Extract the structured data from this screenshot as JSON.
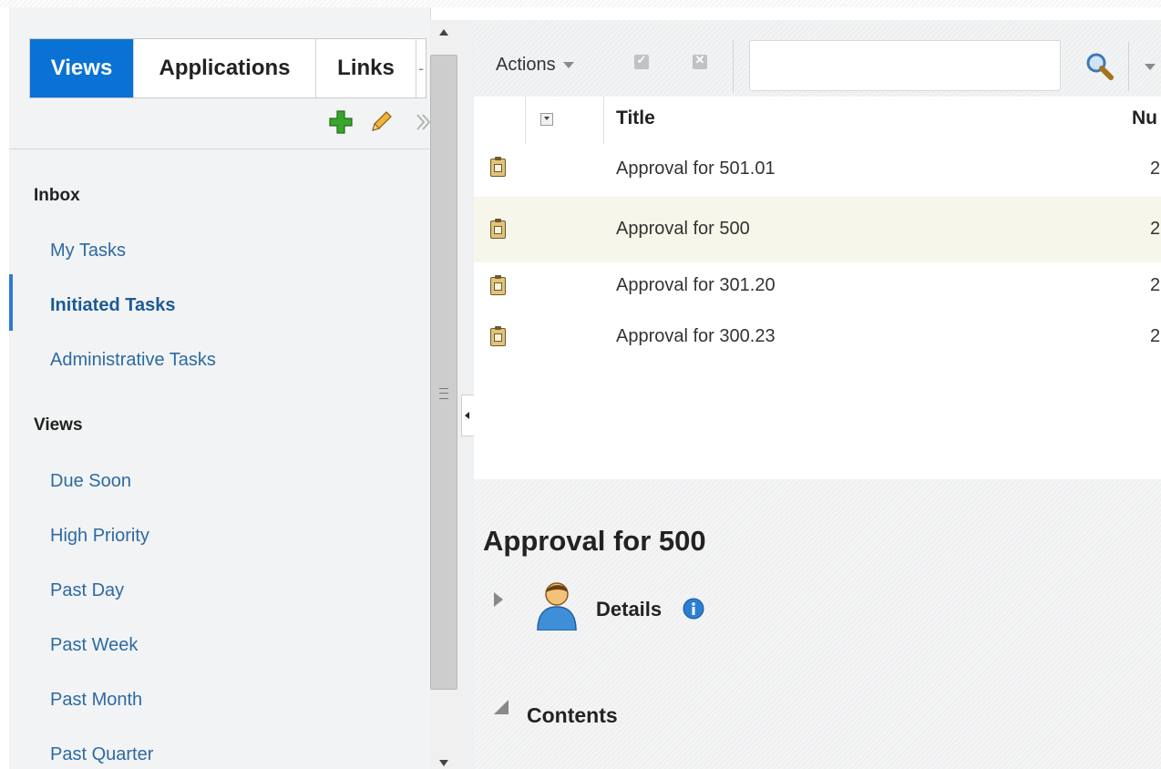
{
  "tabs": {
    "views": "Views",
    "applications": "Applications",
    "links": "Links",
    "more": "-"
  },
  "sidebar": {
    "toolbar_icons": [
      "add-icon",
      "edit-pencil-icon",
      "chevron-right-icon"
    ],
    "inbox_heading": "Inbox",
    "inbox_items": [
      {
        "label": "My Tasks"
      },
      {
        "label": "Initiated Tasks",
        "selected": true
      },
      {
        "label": "Administrative Tasks"
      }
    ],
    "views_heading": "Views",
    "views_items": [
      {
        "label": "Due Soon"
      },
      {
        "label": "High Priority"
      },
      {
        "label": "Past Day"
      },
      {
        "label": "Past Week"
      },
      {
        "label": "Past Month"
      },
      {
        "label": "Past Quarter"
      }
    ]
  },
  "toolbar": {
    "actions_label": "Actions",
    "search_value": ""
  },
  "table": {
    "columns": {
      "title": "Title",
      "number": "Nu"
    },
    "rows": [
      {
        "title": "Approval for 501.01",
        "number": "2",
        "highlighted": false
      },
      {
        "title": "Approval for 500",
        "number": "2",
        "highlighted": true
      },
      {
        "title": "Approval for 301.20",
        "number": "2",
        "highlighted": false
      },
      {
        "title": "Approval for 300.23",
        "number": "2",
        "highlighted": false
      }
    ]
  },
  "detail": {
    "title": "Approval for 500",
    "details_label": "Details",
    "contents_label": "Contents"
  },
  "colors": {
    "active_tab": "#0a72d4",
    "link": "#2d6aa3",
    "selection_bar": "#2e7bd4",
    "row_highlight": "#f7f6ea"
  }
}
